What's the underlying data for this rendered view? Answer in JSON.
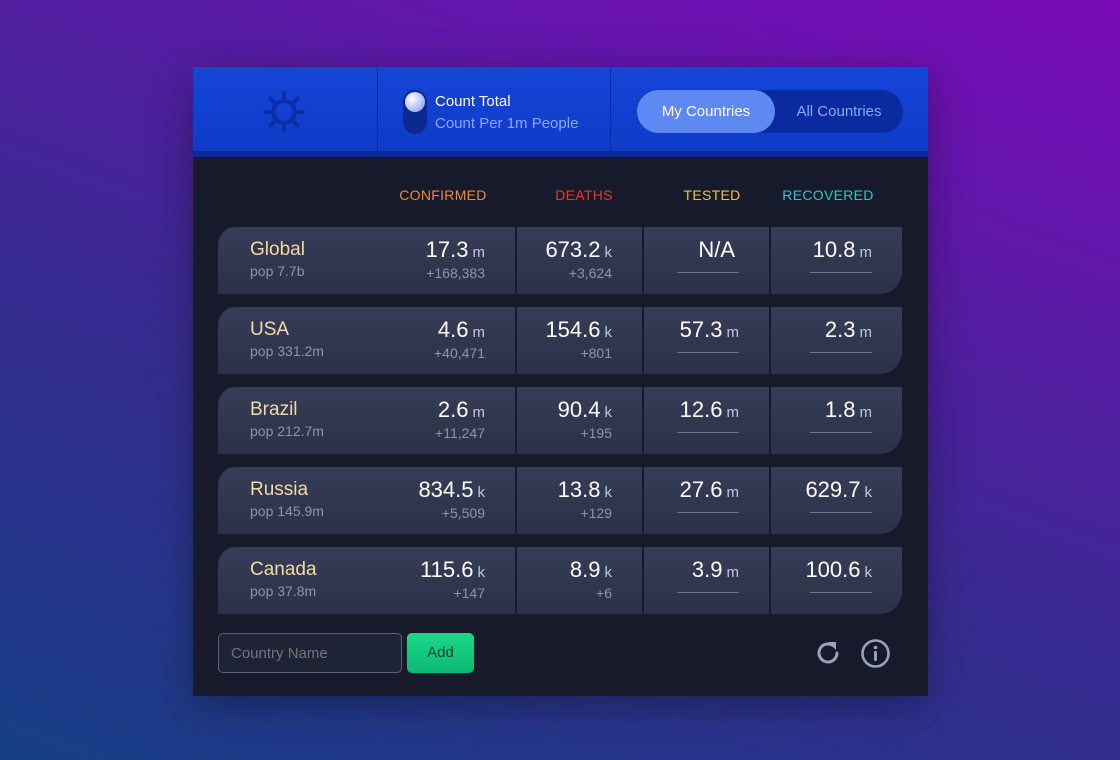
{
  "header": {
    "mode_total": "Count Total",
    "mode_per_million": "Count Per 1m People",
    "tab_my_countries": "My Countries",
    "tab_all_countries": "All Countries"
  },
  "columns": {
    "confirmed": "CONFIRMED",
    "deaths": "DEATHS",
    "tested": "TESTED",
    "recovered": "RECOVERED"
  },
  "colors": {
    "confirmed": "#f08a2c",
    "deaths": "#e83a2a",
    "tested": "#efc23a",
    "recovered": "#2cc8c8"
  },
  "rows": [
    {
      "country": "Global",
      "pop": "pop 7.7b",
      "confirmed": {
        "value": "17.3",
        "unit": "m",
        "delta": "+168,383"
      },
      "deaths": {
        "value": "673.2",
        "unit": "k",
        "delta": "+3,624"
      },
      "tested": {
        "value": "N/A",
        "unit": ""
      },
      "recovered": {
        "value": "10.8",
        "unit": "m"
      }
    },
    {
      "country": "USA",
      "pop": "pop 331.2m",
      "confirmed": {
        "value": "4.6",
        "unit": "m",
        "delta": "+40,471"
      },
      "deaths": {
        "value": "154.6",
        "unit": "k",
        "delta": "+801"
      },
      "tested": {
        "value": "57.3",
        "unit": "m"
      },
      "recovered": {
        "value": "2.3",
        "unit": "m"
      }
    },
    {
      "country": "Brazil",
      "pop": "pop 212.7m",
      "confirmed": {
        "value": "2.6",
        "unit": "m",
        "delta": "+11,247"
      },
      "deaths": {
        "value": "90.4",
        "unit": "k",
        "delta": "+195"
      },
      "tested": {
        "value": "12.6",
        "unit": "m"
      },
      "recovered": {
        "value": "1.8",
        "unit": "m"
      }
    },
    {
      "country": "Russia",
      "pop": "pop 145.9m",
      "confirmed": {
        "value": "834.5",
        "unit": "k",
        "delta": "+5,509"
      },
      "deaths": {
        "value": "13.8",
        "unit": "k",
        "delta": "+129"
      },
      "tested": {
        "value": "27.6",
        "unit": "m"
      },
      "recovered": {
        "value": "629.7",
        "unit": "k"
      }
    },
    {
      "country": "Canada",
      "pop": "pop 37.8m",
      "confirmed": {
        "value": "115.6",
        "unit": "k",
        "delta": "+147"
      },
      "deaths": {
        "value": "8.9",
        "unit": "k",
        "delta": "+6"
      },
      "tested": {
        "value": "3.9",
        "unit": "m"
      },
      "recovered": {
        "value": "100.6",
        "unit": "k"
      }
    }
  ],
  "footer": {
    "search_placeholder": "Country Name",
    "add_label": "Add"
  },
  "icons": {
    "logo": "virus-icon",
    "refresh": "refresh-icon",
    "info": "info-icon"
  }
}
